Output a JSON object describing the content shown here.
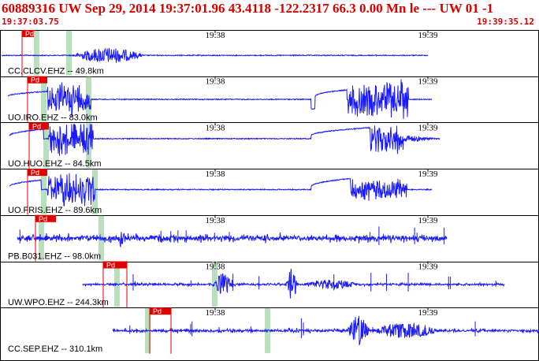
{
  "header": {
    "title": "60889316 UW Sep 29, 2014 19:37:01.96   43.4118 -122.2317 66.3 0.00 Mn le --- UW 01   -1",
    "start_time": "19:37:03.75",
    "end_time": "19:39:35.12"
  },
  "time_ticks": [
    "19:38",
    "19:39"
  ],
  "pick_label": "Pd",
  "colors": {
    "trace": "#1a1aff",
    "pick": "#e00000",
    "header": "#d50000",
    "green_marker": "#b9e0bc",
    "grid": "#000000"
  },
  "traces": [
    {
      "label": "CC.CLCV.EHZ -- 49.8km"
    },
    {
      "label": "UO.IRO.EHZ -- 83.0km"
    },
    {
      "label": "UO.HUO.EHZ -- 84.5km"
    },
    {
      "label": "UO.FRIS.EHZ -- 89.6km"
    },
    {
      "label": "PB.B031.EHZ -- 98.0km"
    },
    {
      "label": "UW.WPO.EHZ -- 244.3km"
    },
    {
      "label": "CC.SEP.EHZ -- 310.1km"
    }
  ]
}
